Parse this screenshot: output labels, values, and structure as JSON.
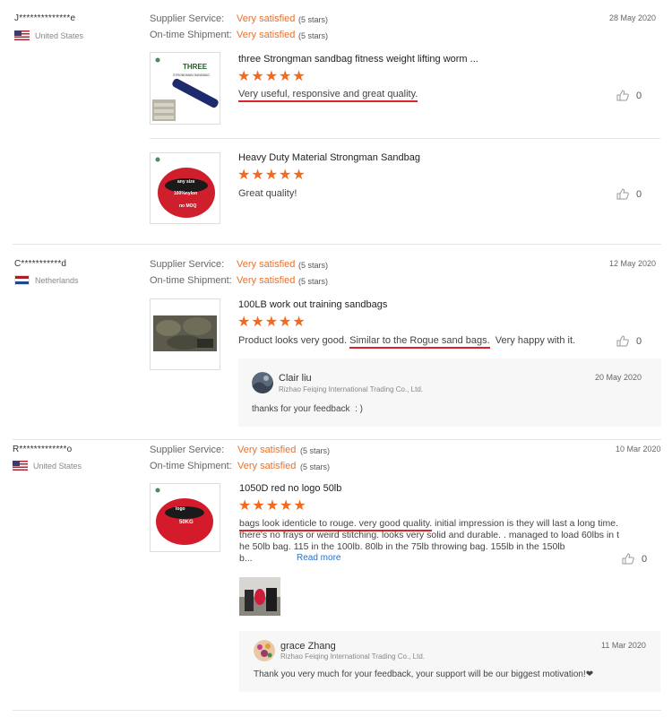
{
  "labels": {
    "supplier_service": "Supplier Service:",
    "ontime_shipment": "On-time Shipment:",
    "stars_note": "(5 stars)",
    "read_more": "Read more"
  },
  "reviews": [
    {
      "reviewer": "J**************e",
      "country": "United States",
      "supplier_service": "Very satisfied",
      "ontime_shipment": "Very satisfied",
      "date": "28 May 2020",
      "products": [
        {
          "title": "three Strongman sandbag fitness weight lifting worm ...",
          "rating": "★★★★★",
          "text": "Very useful, responsive and great quality.",
          "likes": "0",
          "image_label": "THREE",
          "image_sublabel": "STRONGMAN SANDBAG"
        },
        {
          "title": "Heavy Duty Material Strongman Sandbag",
          "rating": "★★★★★",
          "text": "Great quality!",
          "likes": "0",
          "image_label": "any size",
          "image_sublabel": "100%nylon",
          "image_sublabel2": "no MOQ"
        }
      ]
    },
    {
      "reviewer": "C***********d",
      "country": "Netherlands",
      "supplier_service": "Very satisfied",
      "ontime_shipment": "Very satisfied",
      "date": "12 May 2020",
      "products": [
        {
          "title": "100LB work out training sandbags",
          "rating": "★★★★★",
          "text_before": "Product looks very good. ",
          "text_highlight": "Similar to the Rogue sand bags.",
          "text_after": "  Very happy with it.",
          "likes": "0"
        }
      ],
      "reply": {
        "name": "Clair liu",
        "company": "Rizhao Feiqing International Trading Co., Ltd.",
        "date": "20 May 2020",
        "text": "thanks for your feedback  : )"
      }
    },
    {
      "reviewer": "R*************o",
      "country": "United States",
      "supplier_service": "Very satisfied",
      "ontime_shipment": "Very satisfied",
      "date": "10 Mar 2020",
      "products": [
        {
          "title": "1050D red no logo 50lb",
          "rating": "★★★★★",
          "text_highlight": "bags look identicle to rouge. very good quality.",
          "text_line1_rest": " initial impression is they will last a long time.",
          "text_line2": "there's no frays or weird stitching. looks very solid and durable. . managed to load 60lbs in t",
          "text_line3": "he 50lb bag. 115 in the 100lb. 80lb in the 75lb throwing bag. 155lb in the 150lb",
          "text_line4": "b...",
          "likes": "0",
          "image_label": "logo",
          "image_sublabel": "50KG"
        }
      ],
      "reply": {
        "name": "grace Zhang",
        "company": "Rizhao Feiqing International Trading Co., Ltd.",
        "date": "11 Mar 2020",
        "text": "Thank you very much for your feedback, your support will be our biggest motivation!❤"
      }
    }
  ]
}
